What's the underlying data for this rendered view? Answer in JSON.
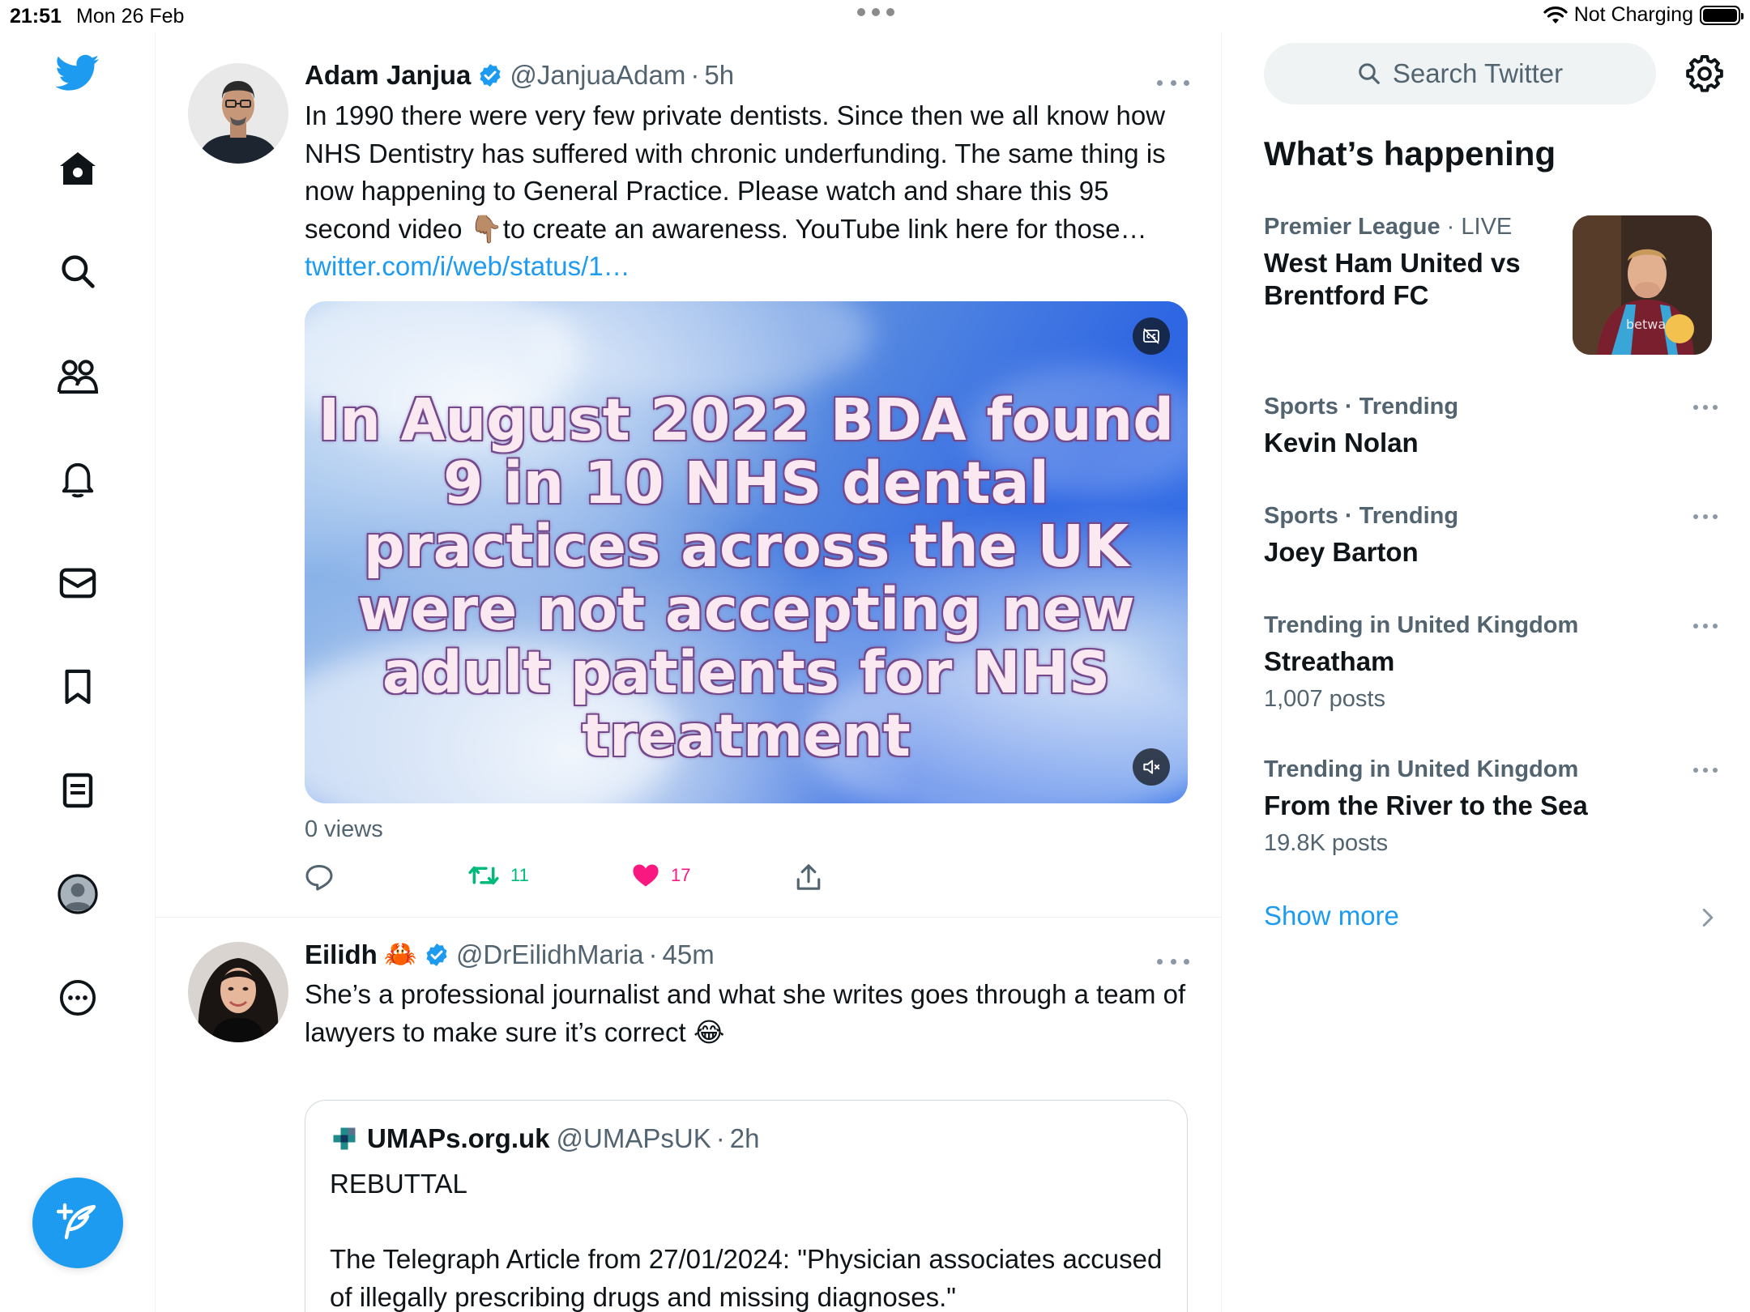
{
  "status_bar": {
    "time": "21:51",
    "date": "Mon 26 Feb",
    "charging": "Not Charging"
  },
  "nav": {
    "items": [
      "home-icon",
      "explore-icon",
      "communities-icon",
      "notifications-icon",
      "messages-icon",
      "bookmarks-icon",
      "lists-icon",
      "profile-icon",
      "more-icon"
    ],
    "brand_color": "#1d9bf0"
  },
  "tweets": [
    {
      "name": "Adam Janjua",
      "handle": "@JanjuaAdam",
      "sep": "·",
      "time": "5h",
      "text": "In 1990 there were very few private dentists. Since then we all know how NHS Dentistry has suffered with chronic underfunding. The same thing is now happening to General Practice. Please watch and share this 95 second video 👇🏽to create an awareness.  YouTube link here for those…",
      "link": "twitter.com/i/web/status/1…",
      "media_text": "In August 2022 BDA found 9 in 10 NHS dental practices across the UK were not accepting new adult patients for NHS treatment",
      "views": "0 views",
      "retweets": "11",
      "likes": "17"
    },
    {
      "name": "Eilidh",
      "emoji": "🦀",
      "handle": "@DrEilidhMaria",
      "sep": "·",
      "time": "45m",
      "text": "She’s a professional journalist and what she writes goes through a team of lawyers to make sure it’s correct 😂",
      "quote": {
        "name": "UMAPs.org.uk",
        "handle": "@UMAPsUK",
        "sep": "·",
        "time": "2h",
        "text": "REBUTTAL\n\nThe Telegraph Article from 27/01/2024: \"Physician associates accused of illegally prescribing drugs and missing diagnoses.\"\n..."
      }
    }
  ],
  "sidebar": {
    "search_placeholder": "Search Twitter",
    "title": "What’s happening",
    "trends": [
      {
        "category": "Premier League",
        "sep": "·",
        "status": "LIVE",
        "topic": "West Ham United vs Brentford FC"
      },
      {
        "category": "Sports · Trending",
        "topic": "Kevin Nolan"
      },
      {
        "category": "Sports · Trending",
        "topic": "Joey Barton"
      },
      {
        "category": "Trending in United Kingdom",
        "topic": "Streatham",
        "count": "1,007 posts"
      },
      {
        "category": "Trending in United Kingdom",
        "topic": "From the River to the Sea",
        "count": "19.8K posts"
      }
    ],
    "show_more": "Show more"
  },
  "colors": {
    "accent": "#1d9bf0",
    "retweet": "#00ba7c",
    "like": "#f91880",
    "secondary_text": "#536471"
  }
}
